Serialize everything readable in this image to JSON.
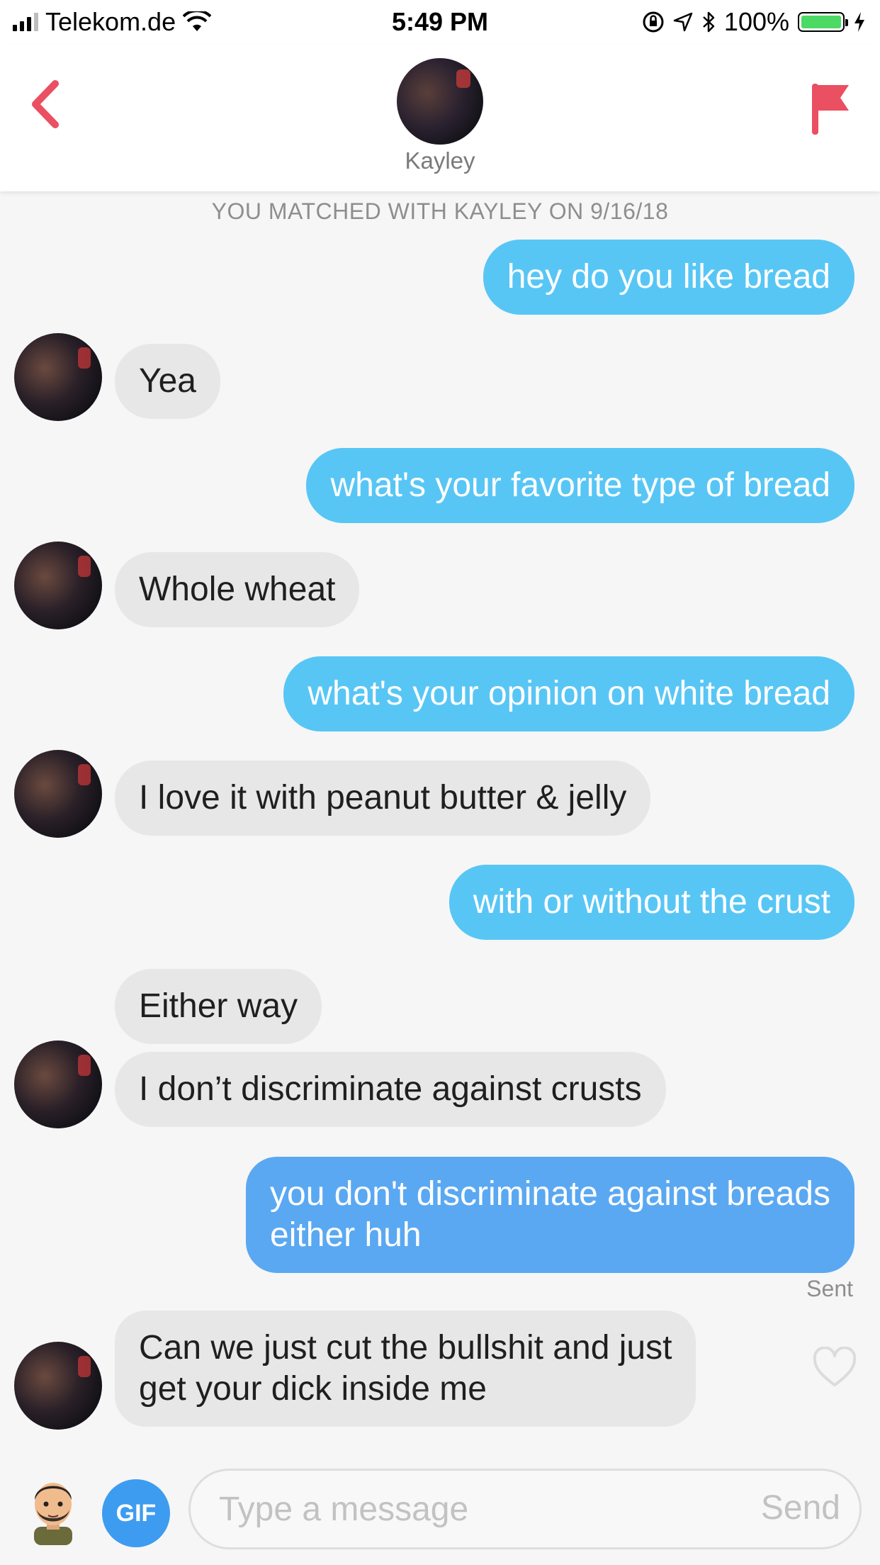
{
  "status_bar": {
    "carrier": "Telekom.de",
    "time": "5:49 PM",
    "battery": "100%"
  },
  "header": {
    "contact_name": "Kayley"
  },
  "match_notice": "YOU MATCHED WITH KAYLEY ON 9/16/18",
  "messages": [
    {
      "from": "me",
      "text": "hey do you like bread"
    },
    {
      "from": "them",
      "text": "Yea"
    },
    {
      "from": "me",
      "text": "what's your favorite type of bread"
    },
    {
      "from": "them",
      "text": "Whole wheat"
    },
    {
      "from": "me",
      "text": "what's your opinion on white bread"
    },
    {
      "from": "them",
      "text": "I love it with peanut butter & jelly"
    },
    {
      "from": "me",
      "text": "with or without the crust"
    },
    {
      "from": "them",
      "text": "Either way"
    },
    {
      "from": "them",
      "text": "I don’t discriminate against crusts"
    },
    {
      "from": "me",
      "lines": [
        "you don't discriminate against breads",
        "either huh"
      ]
    },
    {
      "from": "them",
      "lines": [
        "Can we just cut the bullshit and just",
        "get your dick inside me"
      ]
    }
  ],
  "sent_status": "Sent",
  "composer": {
    "gif_label": "GIF",
    "placeholder": "Type a message",
    "send_label": "Send"
  },
  "colors": {
    "outgoing_bubble": "#58c6f5",
    "incoming_bubble": "#e7e7e7",
    "accent_red": "#ea4f62",
    "gif_blue": "#3d9cf0",
    "battery_green": "#4cd964"
  },
  "icons": {
    "back": "chevron-left-icon",
    "report": "flag-icon",
    "like": "heart-icon",
    "wifi": "wifi-icon",
    "location": "location-arrow-icon",
    "bluetooth": "bluetooth-icon",
    "charging": "bolt-icon",
    "orientation_lock": "orientation-lock-icon"
  }
}
